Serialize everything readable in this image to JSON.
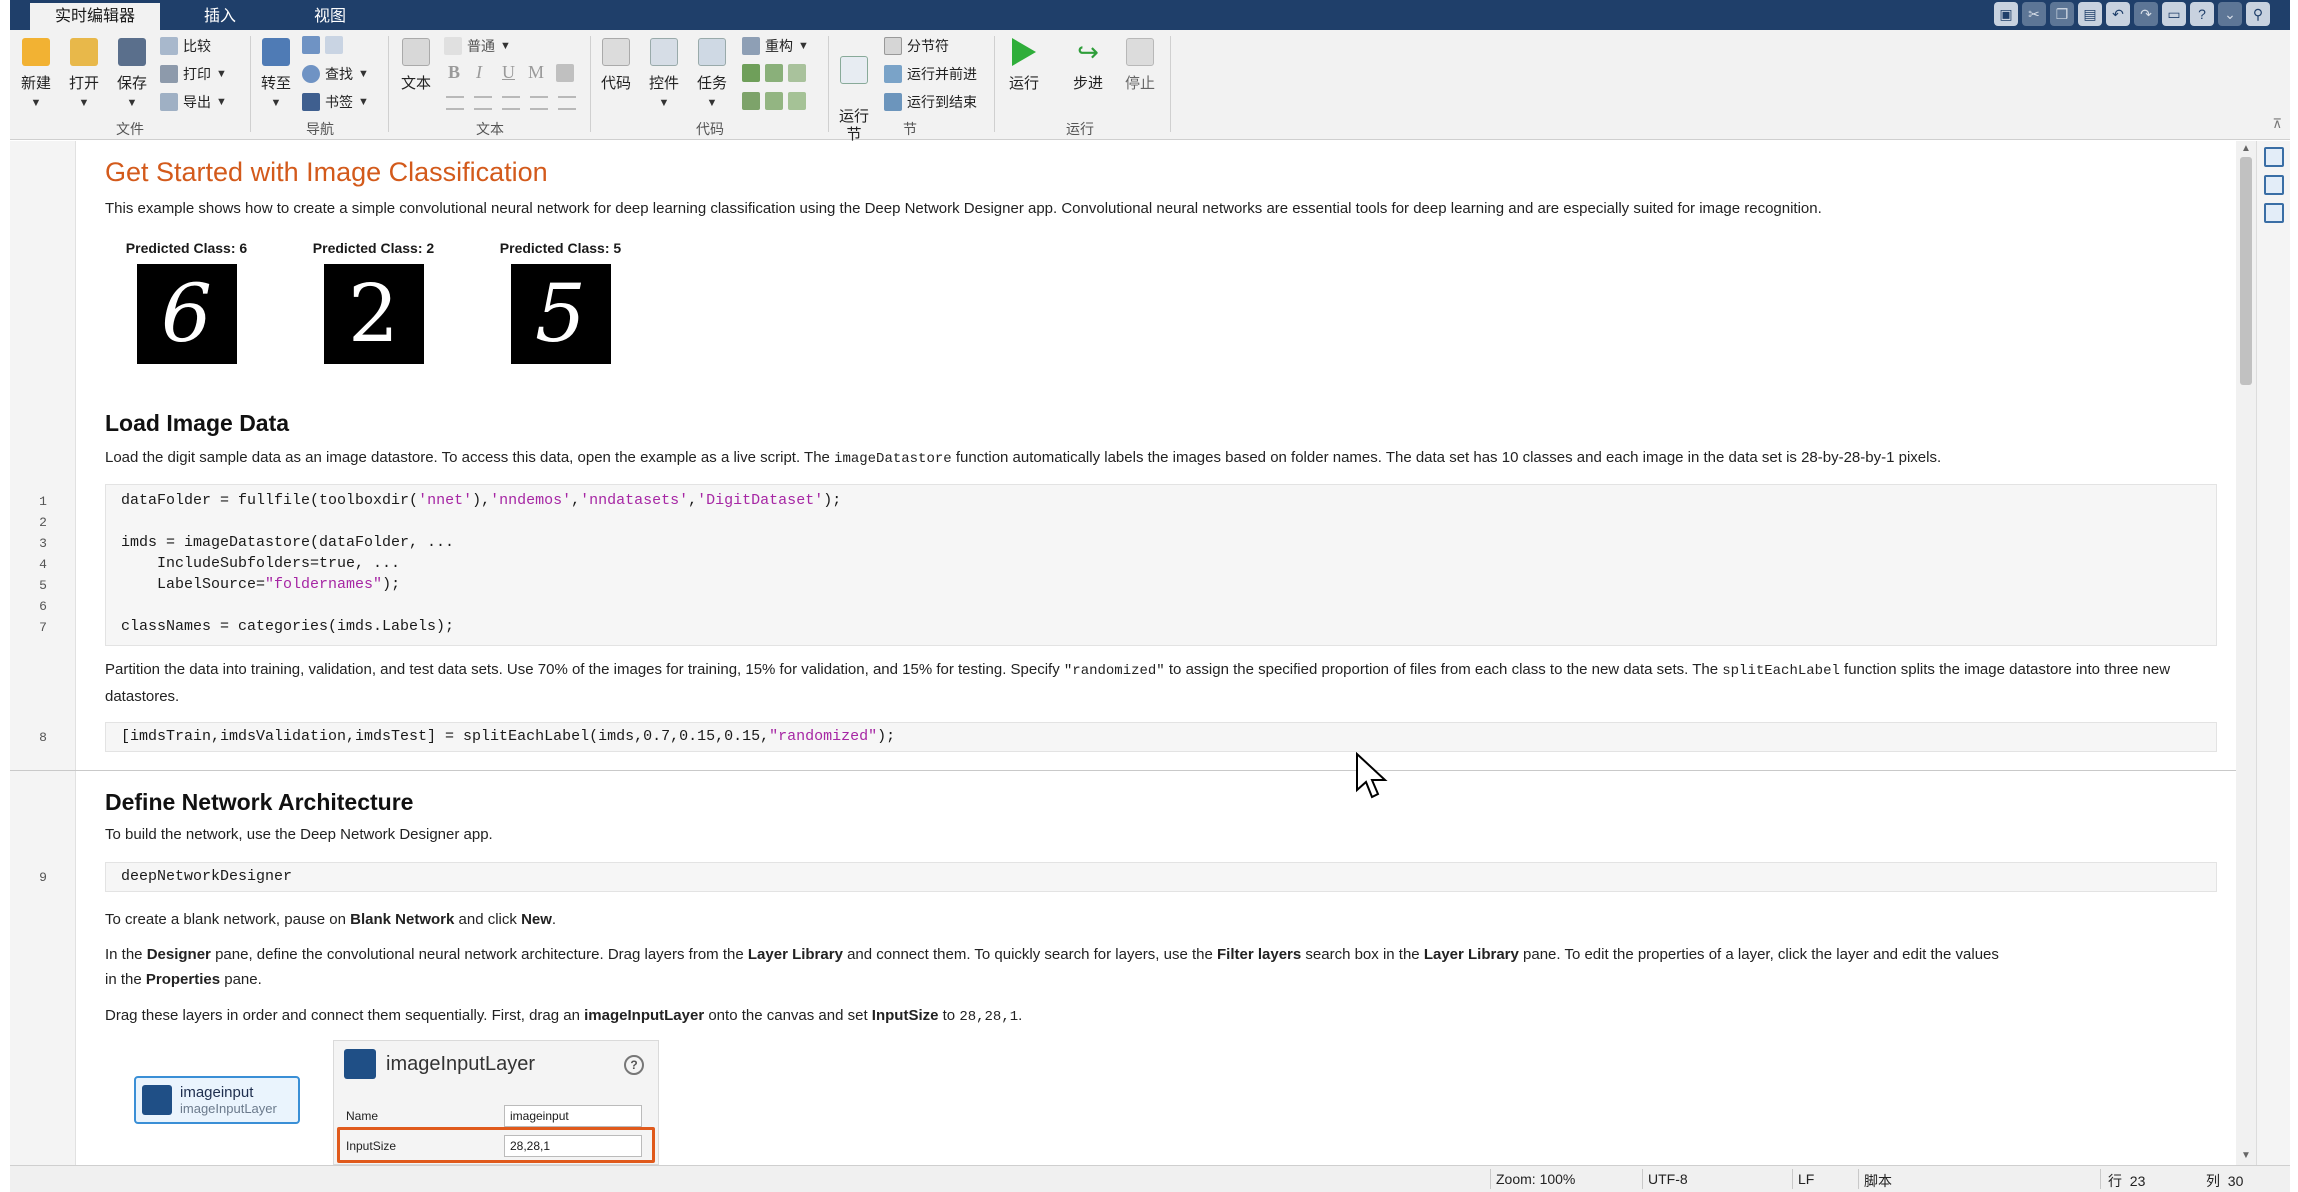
{
  "tabs": [
    {
      "label": "实时编辑器"
    },
    {
      "label": "插入"
    },
    {
      "label": "视图"
    }
  ],
  "ribbon": {
    "file": {
      "group_label": "文件",
      "new_label": "新建",
      "open_label": "打开",
      "save_label": "保存",
      "compare_label": "比较",
      "print_label": "打印",
      "export_label": "导出"
    },
    "navigate": {
      "group_label": "导航",
      "goto_label": "转至",
      "find_label": "查找",
      "bookmark_label": "书签"
    },
    "text": {
      "group_label": "文本",
      "text_label": "文本",
      "style_label": "普通",
      "bold": "B",
      "italic": "I",
      "underline": "U",
      "mono": "M"
    },
    "code": {
      "group_label": "代码",
      "code_label": "代码",
      "control_label": "控件",
      "task_label": "任务",
      "refactor_label": "重构"
    },
    "section": {
      "group_label": "节",
      "run_section_label": "运行\n节",
      "section_break_label": "分节符",
      "run_advance_label": "运行并前进",
      "run_to_end_label": "运行到结束"
    },
    "run": {
      "group_label": "运行",
      "run_label": "运行",
      "step_label": "步进",
      "stop_label": "停止"
    }
  },
  "doc": {
    "title": "Get Started with Image Classification",
    "intro": "This example shows how to create a simple convolutional neural network for deep learning classification using the Deep Network Designer app. Convolutional neural networks are essential tools for deep learning and are especially suited for image recognition.",
    "predictions": [
      {
        "caption": "Predicted Class: 6",
        "digit": "6"
      },
      {
        "caption": "Predicted Class: 2",
        "digit": "2"
      },
      {
        "caption": "Predicted Class: 5",
        "digit": "5"
      }
    ],
    "load": {
      "heading": "Load Image Data",
      "p_before": "Load the digit sample data as an image datastore. To access this data, open the example as a live script. The ",
      "p_code": "imageDatastore",
      "p_after": " function automatically labels the images based on folder names. The data set has 10 classes and each image in the data set is 28-by-28-by-1 pixels."
    },
    "code_lines": [
      {
        "n": "1",
        "pre": "dataFolder = fullfile(toolboxdir(",
        "s1": "'nnet'",
        "mid1": "),",
        "s2": "'nndemos'",
        "mid2": ",",
        "s3": "'nndatasets'",
        "mid3": ",",
        "s4": "'DigitDataset'",
        "post": ");"
      },
      {
        "n": "2",
        "text": ""
      },
      {
        "n": "3",
        "text": "imds = imageDatastore(dataFolder, ..."
      },
      {
        "n": "4",
        "text": "    IncludeSubfolders=true, ..."
      },
      {
        "n": "5",
        "pre": "    LabelSource=",
        "s1": "\"foldernames\"",
        "post": ");"
      },
      {
        "n": "6",
        "text": ""
      },
      {
        "n": "7",
        "text": "classNames = categories(imds.Labels);"
      }
    ],
    "partition": {
      "t1": "Partition the data into training, validation, and test data sets. Use 70% of the images for training, 15% for validation, and 15% for testing. Specify ",
      "c1": "\"randomized\"",
      "t2": " to assign the specified proportion of files from each class to the new data sets. The ",
      "c2": "splitEachLabel",
      "t3": " function splits the image datastore into three new datastores."
    },
    "line8": {
      "n": "8",
      "pre": "[imdsTrain,imdsValidation,imdsTest] = splitEachLabel(imds,0.7,0.15,0.15,",
      "s1": "\"randomized\"",
      "post": ");"
    },
    "network": {
      "heading": "Define Network Architecture",
      "p1": "To build the network, use the Deep Network Designer app.",
      "line9_n": "9",
      "line9": "deepNetworkDesigner",
      "p2_a": "To create a blank network, pause on ",
      "p2_b": "Blank Network",
      "p2_c": " and click ",
      "p2_d": "New",
      "p2_e": ".",
      "p3_a": "In the ",
      "p3_b": "Designer",
      "p3_c": " pane, define the convolutional neural network architecture. Drag layers from the ",
      "p3_d": "Layer Library",
      "p3_e": " and connect them. To quickly search for layers, use the ",
      "p3_f": "Filter layers",
      "p3_g": " search box in the ",
      "p3_h": "Layer Library",
      "p3_i": " pane. To edit the properties of a layer, click the layer and edit the values",
      "p3_j": "in the ",
      "p3_k": "Properties",
      "p3_l": " pane.",
      "p4_a": "Drag these layers in order and connect them sequentially. First, drag an ",
      "p4_b": "imageInputLayer",
      "p4_c": " onto the canvas and set ",
      "p4_d": "InputSize",
      "p4_e": " to ",
      "p4_f": "28,28,1",
      "p4_g": "."
    },
    "layer_node": {
      "name": "imageinput",
      "type": "imageInputLayer"
    },
    "layer_props": {
      "title": "imageInputLayer",
      "help": "?",
      "name_label": "Name",
      "name_value": "imageinput",
      "size_label": "InputSize",
      "size_value": "28,28,1"
    }
  },
  "status": {
    "zoom": "Zoom: 100%",
    "encoding": "UTF-8",
    "eol": "LF",
    "type": "脚本",
    "row": "行  23",
    "col": "列  30"
  },
  "colors": {
    "title_orange": "#d35a1b",
    "string_purple": "#a626a4",
    "tab_bar_blue": "#1f3f6a",
    "highlight_orange": "#e05a1c"
  }
}
